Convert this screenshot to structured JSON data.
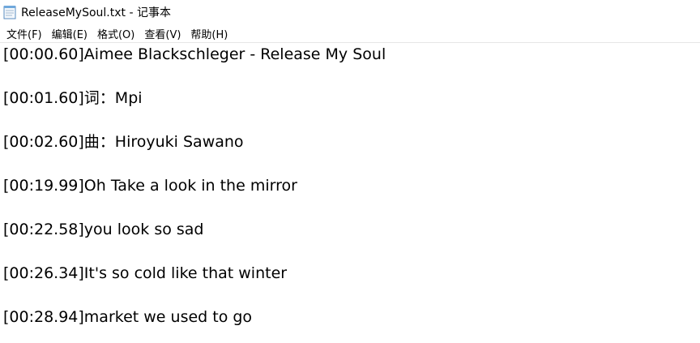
{
  "window": {
    "title": "ReleaseMySoul.txt - 记事本",
    "icon": "notepad-icon"
  },
  "menu": [
    {
      "label": "文件(F)"
    },
    {
      "label": "编辑(E)"
    },
    {
      "label": "格式(O)"
    },
    {
      "label": "查看(V)"
    },
    {
      "label": "帮助(H)"
    }
  ],
  "editor": {
    "lines": [
      "[00:00.60]Aimee Blackschleger - Release My Soul",
      "[00:01.60]词：Mpi",
      "[00:02.60]曲：Hiroyuki Sawano",
      "[00:19.99]Oh Take a look in the mirror",
      "[00:22.58]you look so sad",
      "[00:26.34]It's so cold like that winter",
      "[00:28.94]market we used to go"
    ]
  }
}
